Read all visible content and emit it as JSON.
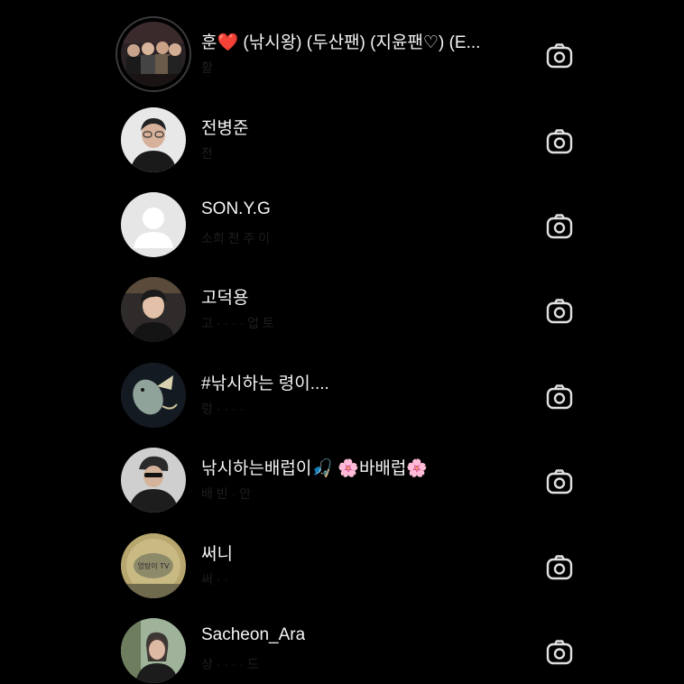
{
  "colors": {
    "background": "#000000",
    "name_text": "#f5f5f5",
    "subtitle_text": "#1e1e1e",
    "camera_icon": "#e0e0e0"
  },
  "accounts": [
    {
      "name": "훈❤️ (낚시왕) (두산팬) (지윤팬♡) (E...",
      "subtitle": "활",
      "icon": "camera-icon"
    },
    {
      "name": "전병준",
      "subtitle": "전",
      "icon": "camera-icon"
    },
    {
      "name": "SON.Y.G",
      "subtitle": "소희 전 주 이",
      "icon": "camera-icon"
    },
    {
      "name": "고덕용",
      "subtitle": "고 · · · · 업 토",
      "icon": "camera-icon"
    },
    {
      "name": "#낚시하는 령이....",
      "subtitle": "렁 · · · ·",
      "icon": "camera-icon"
    },
    {
      "name": "낚시하는배럽이🎣 🌸바배럽🌸",
      "subtitle": "배 빈 · 안",
      "icon": "camera-icon"
    },
    {
      "name": "써니",
      "subtitle": "써 · ·",
      "icon": "camera-icon"
    },
    {
      "name": "Sacheon_Ara",
      "subtitle": "상 · · · · 드",
      "icon": "camera-icon"
    }
  ],
  "badges": {
    "avatar_7_text": "엉탕이 TV"
  }
}
